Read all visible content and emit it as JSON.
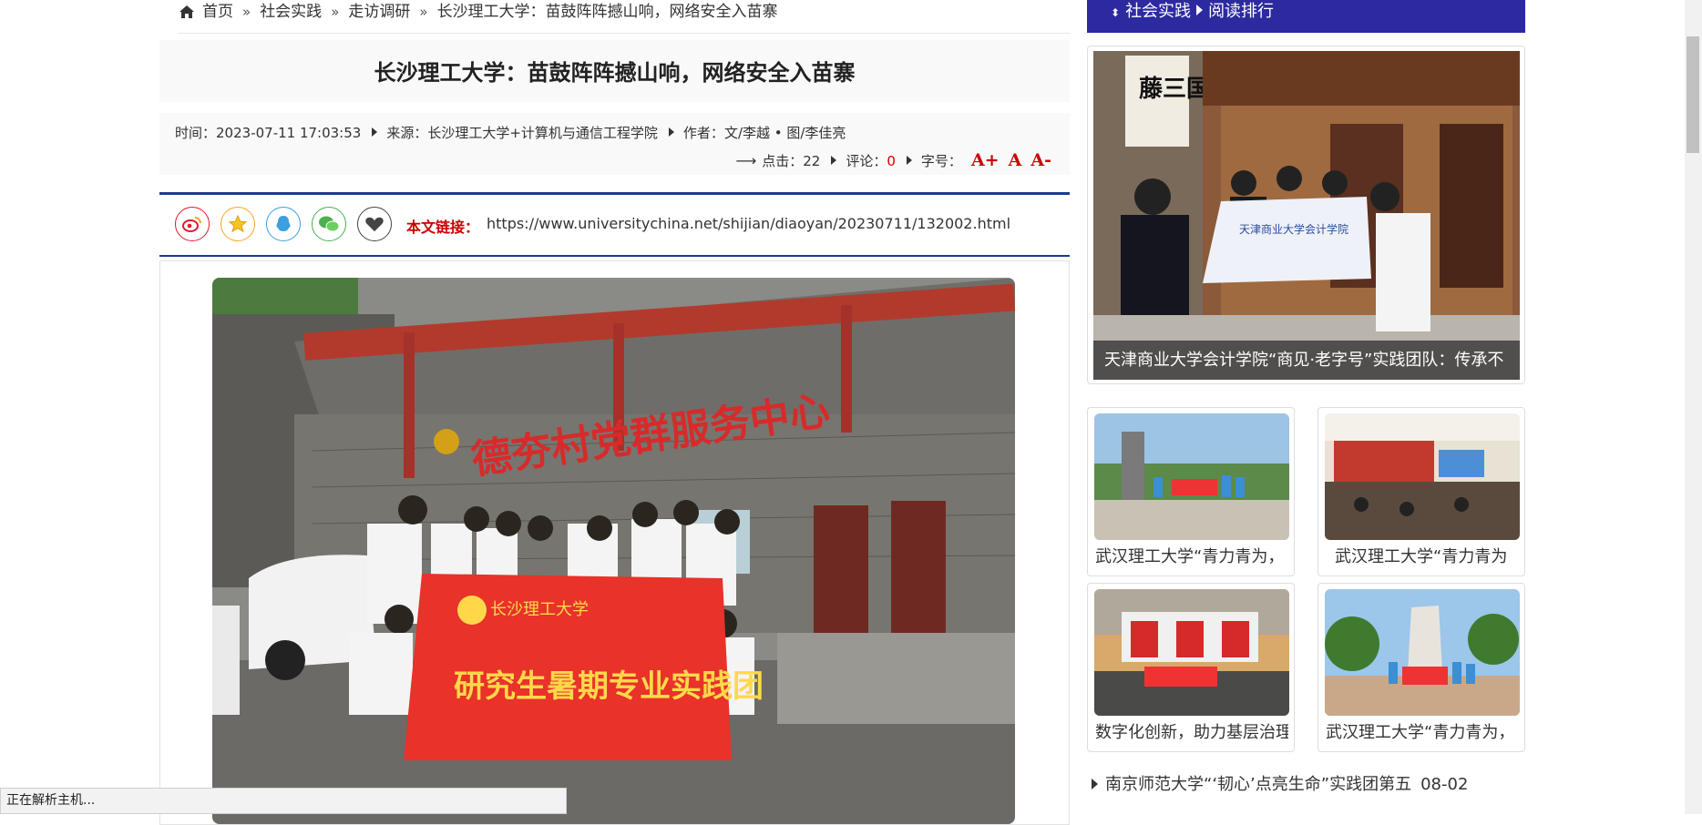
{
  "breadcrumb": {
    "home": "首页",
    "level1": "社会实践",
    "level2": "走访调研",
    "current": "长沙理工大学：苗鼓阵阵撼山响，网络安全入苗寨"
  },
  "article": {
    "title": "长沙理工大学：苗鼓阵阵撼山响，网络安全入苗寨",
    "time_label": "时间：",
    "time": "2023-07-11 17:03:53",
    "source_label": "来源：",
    "source": "长沙理工大学+计算机与通信工程学院",
    "author_label": "作者：",
    "author": "文/李越 • 图/李佳亮",
    "clicks_label": "点击：",
    "clicks": "22",
    "comments_label": "评论：",
    "comments": "0",
    "fontsize_label": "字号：",
    "font_larger": "A+",
    "font_normal": "A",
    "font_smaller": "A-",
    "link_label": "本文链接：",
    "link_url": "https://www.universitychina.net/shijian/diaoyan/20230711/132002.html",
    "photo_sign": "德夯村党群服务中心",
    "photo_banner": "研究生暑期专业实践团",
    "photo_banner_school": "长沙理工大学"
  },
  "share": {
    "icons": [
      "weibo-icon",
      "favorite-star-icon",
      "qq-icon",
      "wechat-icon",
      "heart-icon"
    ],
    "colors": {
      "weibo": "#e6162d",
      "star": "#f5a623",
      "qq": "#3aa0e0",
      "wechat": "#4caf50",
      "heart": "#444444"
    }
  },
  "sidebar": {
    "header_a": "社会实践",
    "header_b": "阅读排行",
    "featured_caption": "天津商业大学会计学院“商见·老字号”实践团队：传承不",
    "featured_sign": "藤三国",
    "cards": [
      {
        "caption": "武汉理工大学“青力青为，"
      },
      {
        "caption": "武汉理工大学“青力青为"
      },
      {
        "caption": "数字化创新，助力基层治理"
      },
      {
        "caption": "武汉理工大学“青力青为，"
      }
    ],
    "list": [
      {
        "title": "南京师范大学“‘韧心’点亮生命”实践团第五",
        "date": "08-02"
      }
    ]
  },
  "status_bar": "正在解析主机...",
  "colors": {
    "accent_blue": "#2c2a9e",
    "rule_blue": "#1a3c8f",
    "red": "#cc0000"
  }
}
